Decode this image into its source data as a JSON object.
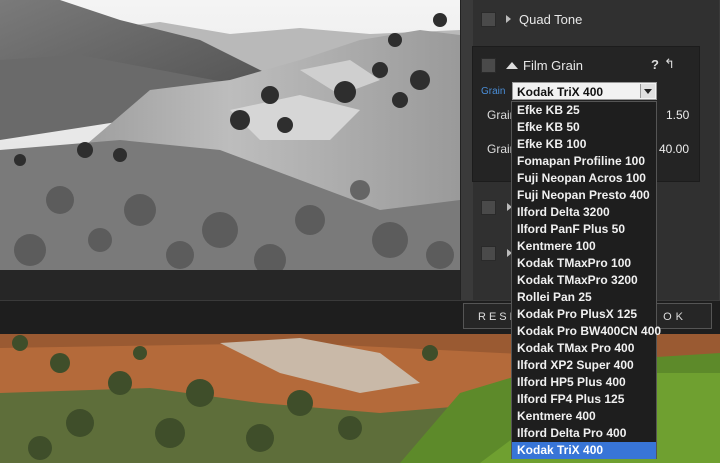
{
  "panel": {
    "sections": {
      "quad_tone": "Quad Tone",
      "film_grain": "Film Grain"
    },
    "film_grain": {
      "help": "?",
      "grain_label": "Grain",
      "selected": "Kodak TriX 400",
      "sliders": [
        {
          "label": "Grain",
          "value": "1.50"
        },
        {
          "label": "Grain",
          "value": "40.00"
        }
      ]
    },
    "buttons": {
      "reset": "RESET",
      "ok": "OK"
    }
  },
  "dropdown": {
    "options": [
      "Efke KB 25",
      "Efke KB 50",
      "Efke KB 100",
      "Fomapan Profiline 100",
      "Fuji Neopan Acros 100",
      "Fuji Neopan Presto 400",
      "Ilford Delta 3200",
      "Ilford PanF Plus 50",
      "Kentmere 100",
      "Kodak TMaxPro 100",
      "Kodak TMaxPro 3200",
      "Rollei Pan 25",
      "Kodak Pro PlusX 125",
      "Kodak Pro BW400CN 400",
      "Kodak TMax Pro 400",
      "Ilford XP2 Super 400",
      "Ilford HP5 Plus 400",
      "Ilford FP4 Plus 125",
      "Kentmere 400",
      "Ilford Delta Pro 400",
      "Kodak TriX 400"
    ],
    "selected_index": 20
  },
  "colors": {
    "accent": "#3875d7",
    "grain_label": "#4a8ed8"
  }
}
